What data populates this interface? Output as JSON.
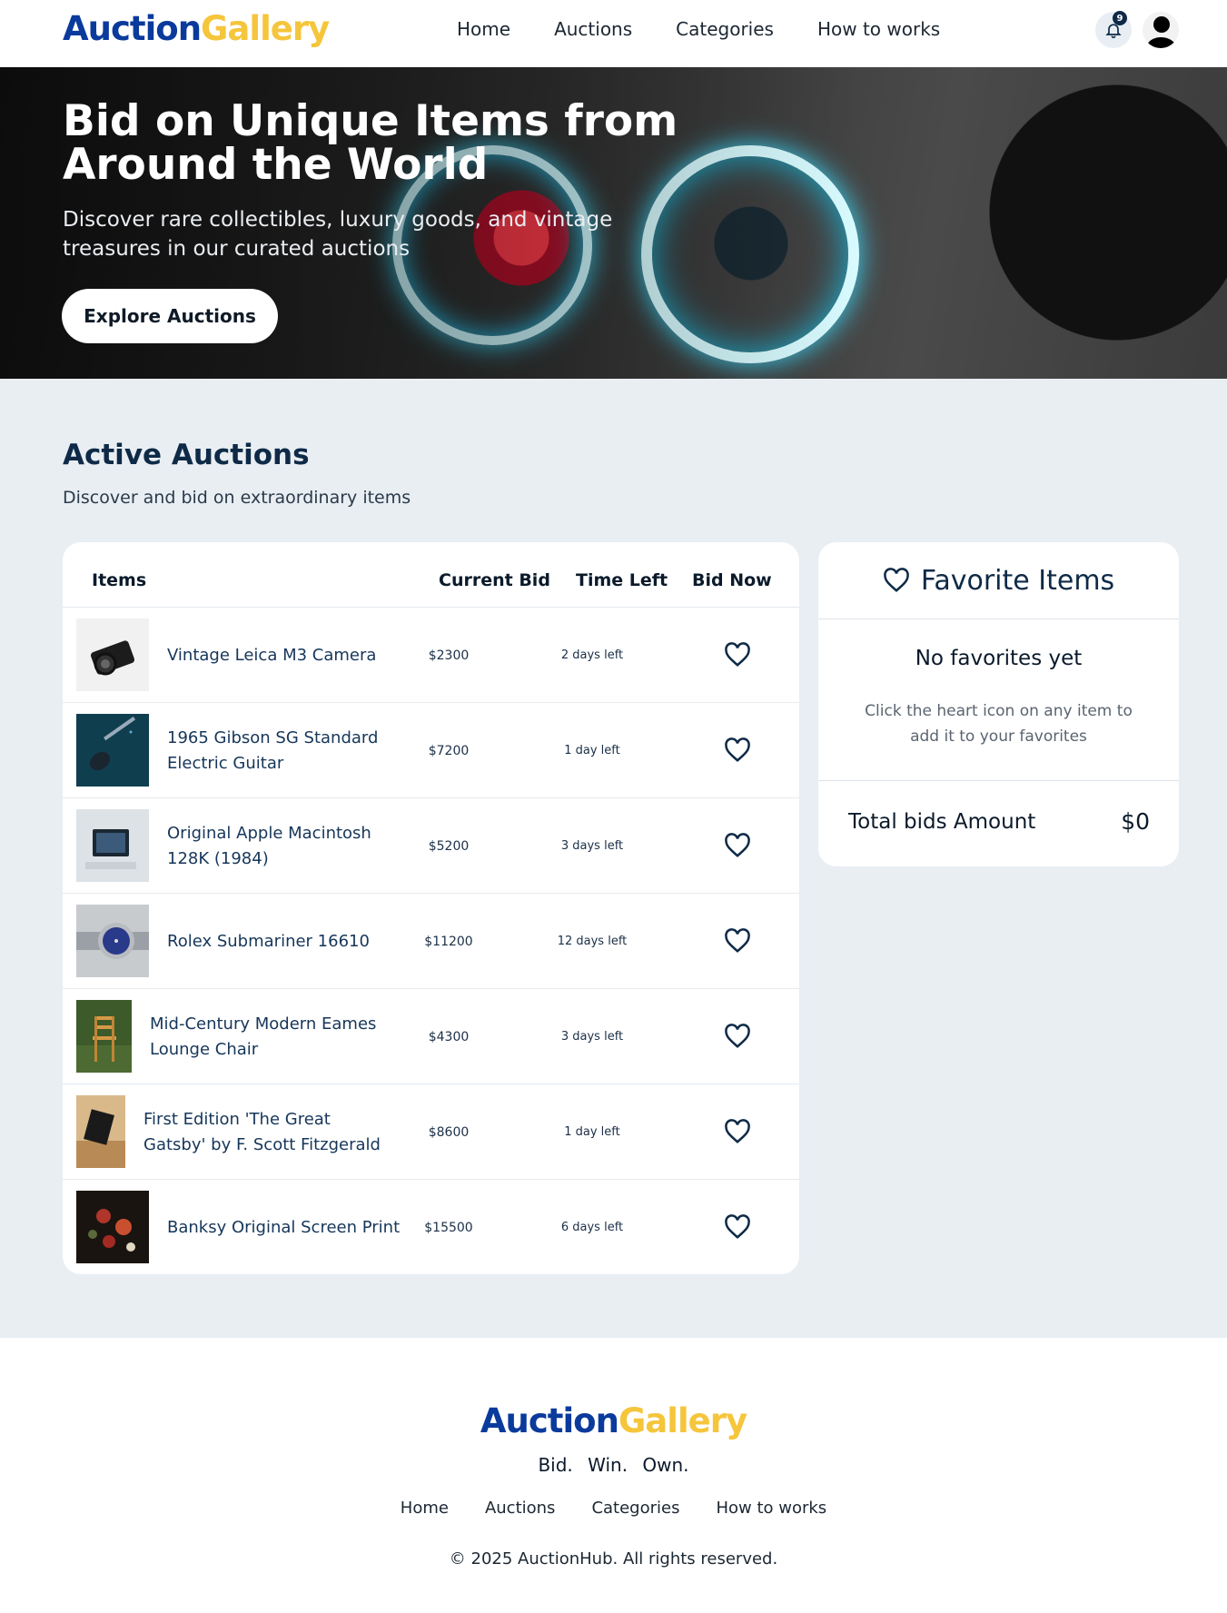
{
  "brand": {
    "part1": "Auction",
    "part2": "Gallery"
  },
  "nav": {
    "links": [
      "Home",
      "Auctions",
      "Categories",
      "How to works"
    ],
    "notification_count": "9"
  },
  "hero": {
    "title": "Bid on Unique Items from Around the World",
    "subtitle": "Discover rare collectibles, luxury goods, and vintage treasures in our curated auctions",
    "button": "Explore Auctions"
  },
  "section": {
    "title": "Active Auctions",
    "subtitle": "Discover and bid on extraordinary items"
  },
  "table": {
    "headers": {
      "items": "Items",
      "current_bid": "Current Bid",
      "time_left": "Time Left",
      "bid_now": "Bid Now"
    },
    "rows": [
      {
        "name": "Vintage Leica M3 Camera",
        "bid": "$2300",
        "time": "2 days left",
        "thumb": "camera"
      },
      {
        "name": "1965 Gibson SG Standard Electric Guitar",
        "bid": "$7200",
        "time": "1 day left",
        "thumb": "guitar"
      },
      {
        "name": "Original Apple Macintosh 128K (1984)",
        "bid": "$5200",
        "time": "3 days left",
        "thumb": "computer"
      },
      {
        "name": "Rolex Submariner 16610",
        "bid": "$11200",
        "time": "12 days left",
        "thumb": "watch"
      },
      {
        "name": "Mid-Century Modern Eames Lounge Chair",
        "bid": "$4300",
        "time": "3 days left",
        "thumb": "chair"
      },
      {
        "name": "First Edition 'The Great Gatsby' by F. Scott Fitzgerald",
        "bid": "$8600",
        "time": "1 day left",
        "thumb": "book"
      },
      {
        "name": "Banksy Original Screen Print",
        "bid": "$15500",
        "time": "6 days left",
        "thumb": "painting"
      }
    ]
  },
  "favorites": {
    "title": "Favorite Items",
    "empty_title": "No favorites yet",
    "empty_hint": "Click the heart icon on any item to add it to your favorites",
    "total_label": "Total bids Amount",
    "total_value": "$0"
  },
  "footer": {
    "tagline": "Bid. Win. Own.",
    "links": [
      "Home",
      "Auctions",
      "Categories",
      "How to works"
    ],
    "copyright": "© 2025 AuctionHub. All rights reserved."
  },
  "colors": {
    "brand_blue": "#0a3a9c",
    "brand_yellow": "#f5c53b",
    "navy": "#0e2a47",
    "bg": "#e9eef3"
  }
}
